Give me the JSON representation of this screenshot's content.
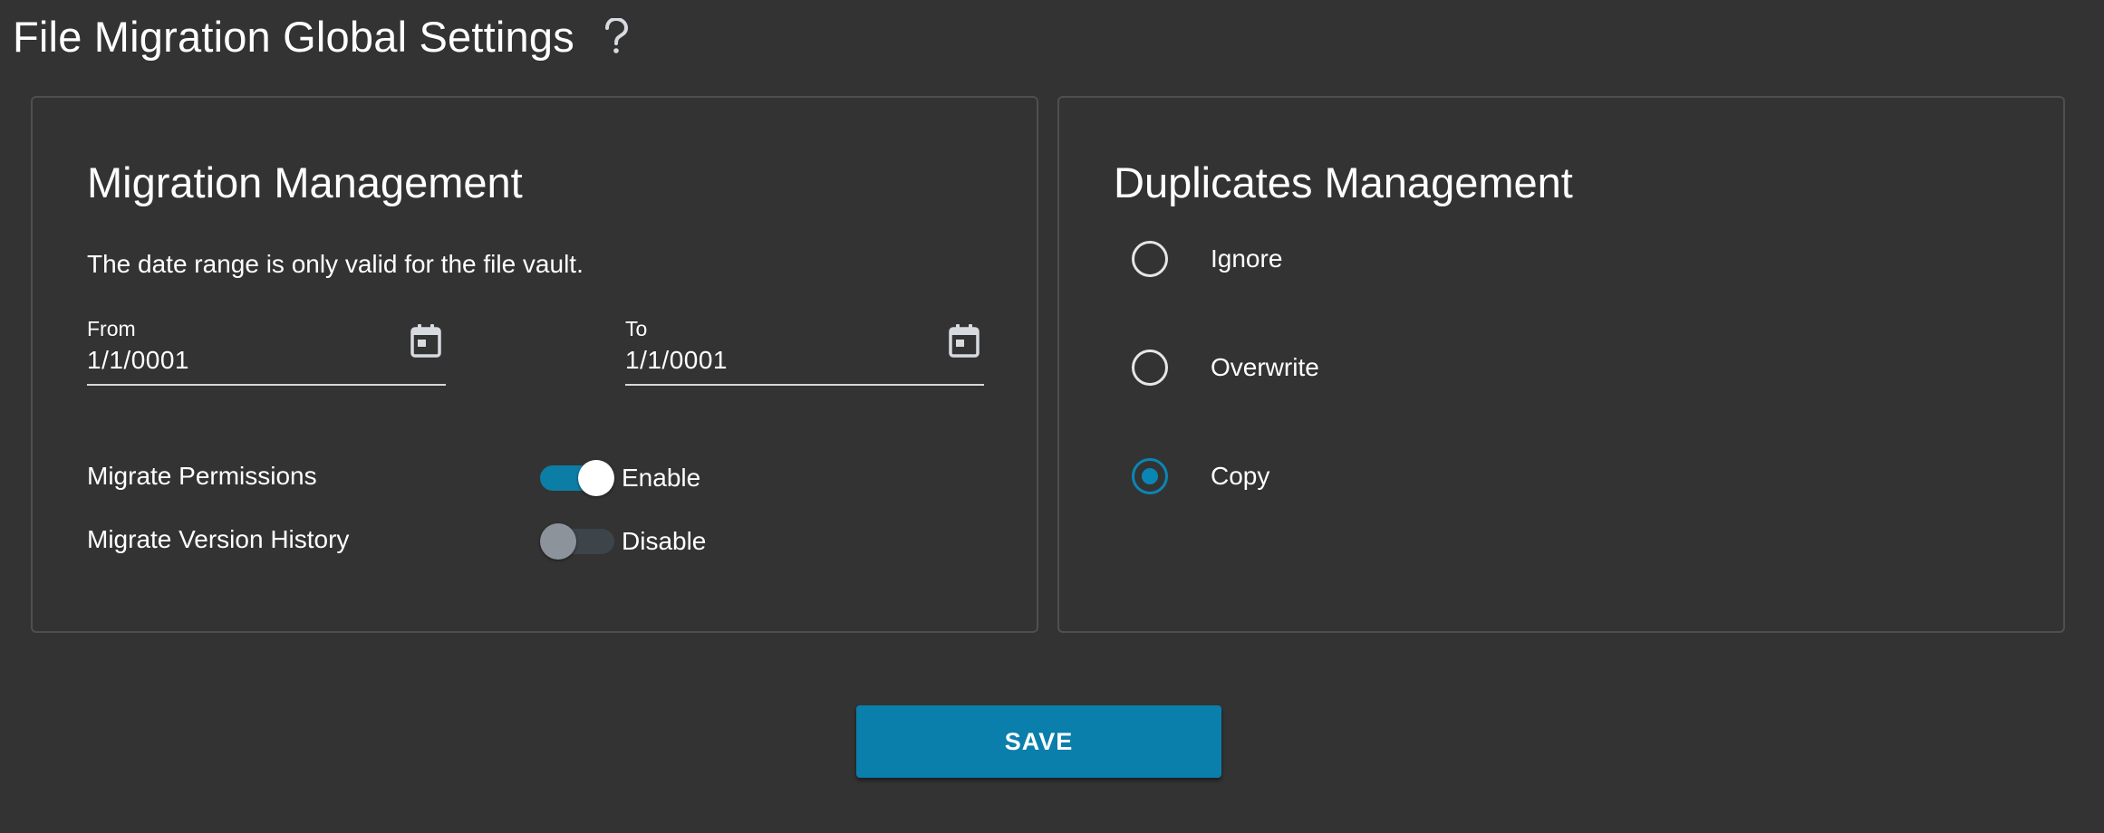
{
  "header": {
    "title": "File Migration Global Settings",
    "help_icon": "question-mark-icon"
  },
  "migration_panel": {
    "title": "Migration Management",
    "hint": "The date range is only valid for the file vault.",
    "from": {
      "label": "From",
      "value": "1/1/0001",
      "icon": "calendar-icon"
    },
    "to": {
      "label": "To",
      "value": "1/1/0001",
      "icon": "calendar-icon"
    },
    "permissions": {
      "label": "Migrate Permissions",
      "state_text": "Enable",
      "enabled": true
    },
    "version_history": {
      "label": "Migrate Version History",
      "state_text": "Disable",
      "enabled": false
    }
  },
  "duplicates_panel": {
    "title": "Duplicates Management",
    "options": [
      {
        "label": "Ignore",
        "selected": false
      },
      {
        "label": "Overwrite",
        "selected": false
      },
      {
        "label": "Copy",
        "selected": true
      }
    ]
  },
  "save_label": "SAVE",
  "colors": {
    "background": "#333333",
    "accent": "#0a7fab",
    "switch_on_track": "#0c7ea6",
    "switch_off_track": "#3d444a",
    "border": "#4f4f4f"
  }
}
